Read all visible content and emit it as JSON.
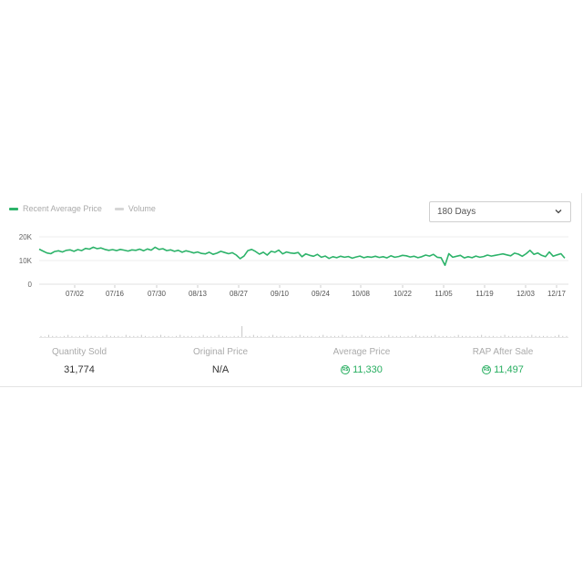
{
  "legend": {
    "items": [
      {
        "label": "Recent Average Price",
        "color": "#2db36a"
      },
      {
        "label": "Volume",
        "color": "#d6d6d6"
      }
    ]
  },
  "range_select": {
    "value": "180 Days"
  },
  "chart_data": {
    "type": "line",
    "y_ticks": [
      "20K",
      "10K",
      "0"
    ],
    "ylim": [
      0,
      20000
    ],
    "x_ticks": [
      "07/02",
      "07/16",
      "07/30",
      "08/13",
      "08/27",
      "09/10",
      "09/24",
      "10/08",
      "10/22",
      "11/05",
      "11/19",
      "12/03",
      "12/17"
    ],
    "grid": true,
    "series": [
      {
        "name": "Recent Average Price",
        "color": "#2db36a",
        "values": [
          14800,
          14000,
          13200,
          12900,
          13800,
          14100,
          13600,
          14300,
          14500,
          13900,
          14600,
          14200,
          15100,
          14800,
          15600,
          15000,
          15300,
          14700,
          14300,
          14600,
          14200,
          14700,
          14400,
          14000,
          14500,
          14300,
          14800,
          14100,
          14900,
          14400,
          15600,
          14700,
          15000,
          14200,
          14500,
          13900,
          14300,
          13500,
          14100,
          13700,
          13200,
          13600,
          13000,
          12800,
          13500,
          12600,
          13100,
          13900,
          13400,
          12900,
          13300,
          12300,
          10800,
          11900,
          14200,
          14700,
          13800,
          12700,
          13500,
          12300,
          13900,
          13500,
          14400,
          12800,
          13600,
          13200,
          13000,
          13400,
          11600,
          12800,
          12200,
          11800,
          12600,
          11400,
          11900,
          10900,
          11600,
          11200,
          11800,
          11400,
          11700,
          11000,
          11500,
          11900,
          11200,
          11600,
          11400,
          11800,
          11300,
          11600,
          11100,
          12000,
          11400,
          11700,
          12200,
          12000,
          11500,
          11800,
          11200,
          11600,
          12300,
          11900,
          12600,
          11400,
          11200,
          8000,
          12900,
          11400,
          11800,
          12200,
          11100,
          11600,
          11200,
          11900,
          11400,
          11700,
          12300,
          11900,
          12200,
          12500,
          12800,
          12400,
          12000,
          13100,
          12700,
          11800,
          12900,
          14300,
          12600,
          13200,
          12200,
          11600,
          13600,
          11800,
          12400,
          12900,
          11000
        ],
        "volume": [
          1,
          0,
          2,
          1,
          1,
          0,
          1,
          2,
          1,
          0,
          1,
          1,
          2,
          1,
          1,
          0,
          1,
          2,
          1,
          1,
          1,
          0,
          2,
          1,
          1,
          1,
          2,
          1,
          0,
          1,
          1,
          2,
          1,
          1,
          0,
          1,
          2,
          1,
          1,
          1,
          0,
          1,
          2,
          1,
          1,
          1,
          2,
          1,
          1,
          0,
          1,
          1,
          10,
          1,
          1,
          2,
          1,
          1,
          0,
          1,
          2,
          1,
          1,
          1,
          0,
          1,
          1,
          2,
          1,
          1,
          1,
          0,
          1,
          2,
          1,
          1,
          1,
          1,
          2,
          1,
          0,
          1,
          1,
          2,
          1,
          1,
          1,
          0,
          1,
          1,
          2,
          1,
          1,
          1,
          0,
          1,
          1,
          2,
          1,
          1,
          1,
          1,
          2,
          1,
          1,
          1,
          0,
          1,
          2,
          1,
          1,
          1,
          0,
          1,
          2,
          1,
          1,
          1,
          0,
          1,
          2,
          1,
          1,
          1,
          1,
          0,
          1,
          2,
          1,
          1,
          1,
          1,
          0,
          1,
          2,
          1,
          1
        ]
      }
    ]
  },
  "stats": [
    {
      "label": "Quantity Sold",
      "value": "31,774",
      "coin": false
    },
    {
      "label": "Original Price",
      "value": "N/A",
      "coin": false
    },
    {
      "label": "Average Price",
      "value": "11,330",
      "coin": true
    },
    {
      "label": "RAP After Sale",
      "value": "11,497",
      "coin": true
    }
  ],
  "coin_glyph": "R$",
  "icons": {
    "dropdown": "chevron-down-icon",
    "currency": "robux-coin-icon"
  }
}
